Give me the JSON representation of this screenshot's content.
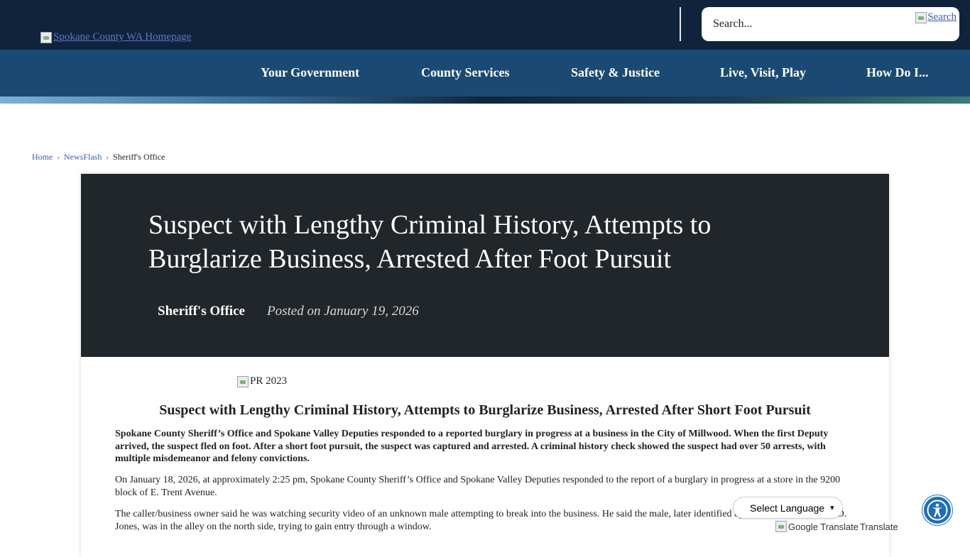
{
  "header": {
    "logo_alt": "Spokane County WA Homepage",
    "search_placeholder": "Search...",
    "search_button_alt": "Search"
  },
  "nav": {
    "items": [
      "Your Government",
      "County Services",
      "Safety & Justice",
      "Live, Visit, Play",
      "How Do I..."
    ]
  },
  "breadcrumb": [
    "Home",
    "NewsFlash",
    "Sheriff's Office"
  ],
  "article": {
    "title": "Suspect with Lengthy Criminal History, Attempts to Burglarize Business, Arrested After Foot Pursuit",
    "department": "Sheriff's Office",
    "posted": "Posted on January 19, 2026",
    "image_alt": "PR 2023",
    "subtitle": "Suspect with Lengthy Criminal History, Attempts to Burglarize Business, Arrested After Short Foot Pursuit",
    "summary": "Spokane County Sheriff’s Office and Spokane Valley Deputies responded to a reported burglary in progress at a business in the City of Millwood.   When the first Deputy arrived, the suspect fled on foot.  After a short foot pursuit, the suspect was captured and arrested.  A criminal history check showed the suspect had over 50 arrests, with multiple misdemeanor and felony convictions.",
    "paragraph1": "On January 18, 2026, at approximately 2:25 pm, Spokane County Sheriff’s Office and Spokane Valley Deputies responded to the report of a burglary in progress at a store in the 9200 block of E. Trent Avenue.",
    "paragraph2": "The caller/business owner said he was watching security video of an unknown male attempting to break into the business.  He said the male, later identified by Deputies as Lawrence D. Jones, was in the alley on the north side, trying to gain entry through a window."
  },
  "widgets": {
    "language_select": "Select Language",
    "translate_credit_alt": "Google Translate",
    "translate_credit_text": "Translate"
  }
}
